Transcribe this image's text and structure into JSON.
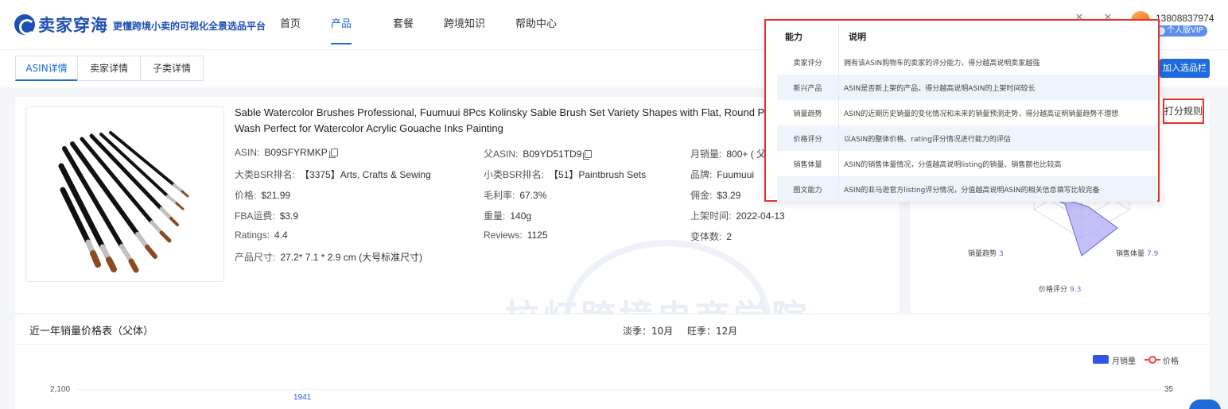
{
  "brand": {
    "name": "卖家穿海",
    "slogan": "更懂跨境小卖的可视化全景选品平台",
    "primary_color": "#1e6bdc",
    "accent_red": "#e0342d"
  },
  "nav": {
    "items": [
      {
        "label": "首页"
      },
      {
        "label": "产品",
        "active": true
      },
      {
        "label": "套餐"
      },
      {
        "label": "跨境知识"
      },
      {
        "label": "帮助中心"
      }
    ]
  },
  "user": {
    "phone": "13808837974",
    "plan_badge": "个人版VIP"
  },
  "tabs": [
    {
      "label": "ASIN详情",
      "active": true
    },
    {
      "label": "卖家详情"
    },
    {
      "label": "子类详情"
    }
  ],
  "add_button": "加入选品栏",
  "rule_button": "打分规则",
  "product": {
    "title_line1": "Sable Watercolor Brushes Professional, Fuumuui 8Pcs Kolinsky Sable Brush Set Variety Shapes with Flat, Round Pointed",
    "title_line2": "Wash Perfect for Watercolor Acrylic Gouache Inks Painting",
    "asin_label": "ASIN:",
    "asin": "B09SFYRMKP",
    "parent_asin_label": "父ASIN:",
    "parent_asin": "B09YD51TD9",
    "monthly_sales_label": "月销量:",
    "monthly_sales": "800+ ( 父",
    "main_bsr_label": "大类BSR排名:",
    "main_bsr": "【3375】Arts, Crafts & Sewing",
    "sub_bsr_label": "小类BSR排名:",
    "sub_bsr": "【51】Paintbrush Sets",
    "brand_label": "品牌:",
    "brand": "Fuumuui",
    "price_label": "价格:",
    "price": "$21.99",
    "margin_label": "毛利率:",
    "margin": "67.3%",
    "commission_label": "佣金:",
    "commission": "$3.29",
    "fba_label": "FBA运费:",
    "fba": "$3.9",
    "weight_label": "重量:",
    "weight": "140g",
    "launch_label": "上架时间:",
    "launch": "2022-04-13",
    "ratings_label": "Ratings:",
    "ratings": "4.4",
    "reviews_label": "Reviews:",
    "reviews": "1125",
    "variants_label": "变体数:",
    "variants": "2",
    "size_label": "产品尺寸:",
    "size": "27.2* 7.1 * 2.9 cm (大号标准尺寸)"
  },
  "watermark": "拉灯跨境电商学院",
  "radar": {
    "labels": [
      {
        "name": "销量趋势",
        "value": "3"
      },
      {
        "name": "销售体量",
        "value": "7.9"
      },
      {
        "name": "价格评分",
        "value": "9.3"
      }
    ]
  },
  "popover": {
    "header": {
      "c1": "能力",
      "c2": "说明"
    },
    "rows": [
      {
        "c1": "卖家评分",
        "c2": "拥有该ASIN购物车的卖家的评分能力，得分越高说明卖家越强"
      },
      {
        "c1": "新兴产品",
        "c2": "ASIN是否新上架的产品，得分越高说明ASIN的上架时间较长"
      },
      {
        "c1": "销量趋势",
        "c2": "ASIN的近期历史销量的变化情况和未来的销量预测走势，得分越高证明销量趋势不理想"
      },
      {
        "c1": "价格评分",
        "c2": "以ASIN的整体价格、rating评分情况进行能力的评估"
      },
      {
        "c1": "销售体量",
        "c2": "ASIN的销售体量情况，分值越高说明listing的销量、销售额也比较高"
      },
      {
        "c1": "图文能力",
        "c2": "ASIN的亚马逊官方listing评分情况，分值越高说明ASIN的相关信息填写比较完备"
      }
    ]
  },
  "sales": {
    "title": "近一年销量价格表（父体）",
    "low_season": "淡季：10月",
    "peak_season": "旺季：12月",
    "legend_sales": "月销量",
    "legend_price": "价格"
  },
  "chart_data": {
    "type": "bar",
    "title": "近一年销量价格表（父体）",
    "series": [
      {
        "name": "月销量",
        "values": [
          1941
        ]
      },
      {
        "name": "价格",
        "values": []
      }
    ],
    "y_left_ticks": [
      "2,100"
    ],
    "y_right_ticks": [
      "35"
    ],
    "visible_bar_label": "1941"
  }
}
